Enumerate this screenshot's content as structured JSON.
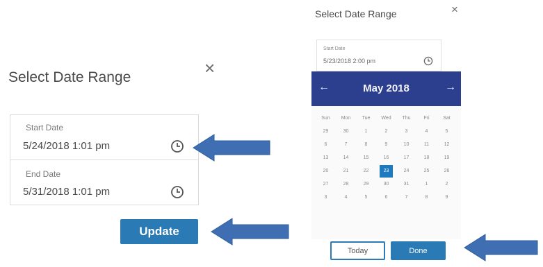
{
  "left_panel": {
    "title": "Select Date Range",
    "close": "×",
    "start_label": "Start Date",
    "start_value": "5/24/2018 1:01 pm",
    "end_label": "End Date",
    "end_value": "5/31/2018 1:01 pm",
    "update": "Update"
  },
  "right_panel": {
    "title": "Select Date Range",
    "close": "×",
    "start_label": "Start Date",
    "start_value": "5/23/2018 2:00 pm",
    "month": "May 2018",
    "prev": "←",
    "next": "→",
    "weekdays": [
      "Sun",
      "Mon",
      "Tue",
      "Wed",
      "Thu",
      "Fri",
      "Sat"
    ],
    "days": [
      [
        "29",
        "30",
        "1",
        "2",
        "3",
        "4",
        "5"
      ],
      [
        "6",
        "7",
        "8",
        "9",
        "10",
        "11",
        "12"
      ],
      [
        "13",
        "14",
        "15",
        "16",
        "17",
        "18",
        "19"
      ],
      [
        "20",
        "21",
        "22",
        "23",
        "24",
        "25",
        "26"
      ],
      [
        "27",
        "28",
        "29",
        "30",
        "31",
        "1",
        "2"
      ],
      [
        "3",
        "4",
        "5",
        "6",
        "7",
        "8",
        "9"
      ]
    ],
    "selected_day": "23",
    "today": "Today",
    "done": "Done"
  },
  "colors": {
    "accent": "#2a7ab6",
    "calendar_header": "#2c3e8e",
    "arrow": "#3f6fb2"
  },
  "icons": [
    "close-icon",
    "clock-icon",
    "arrow-left-icon",
    "arrow-right-icon",
    "annotation-arrow-icon"
  ]
}
